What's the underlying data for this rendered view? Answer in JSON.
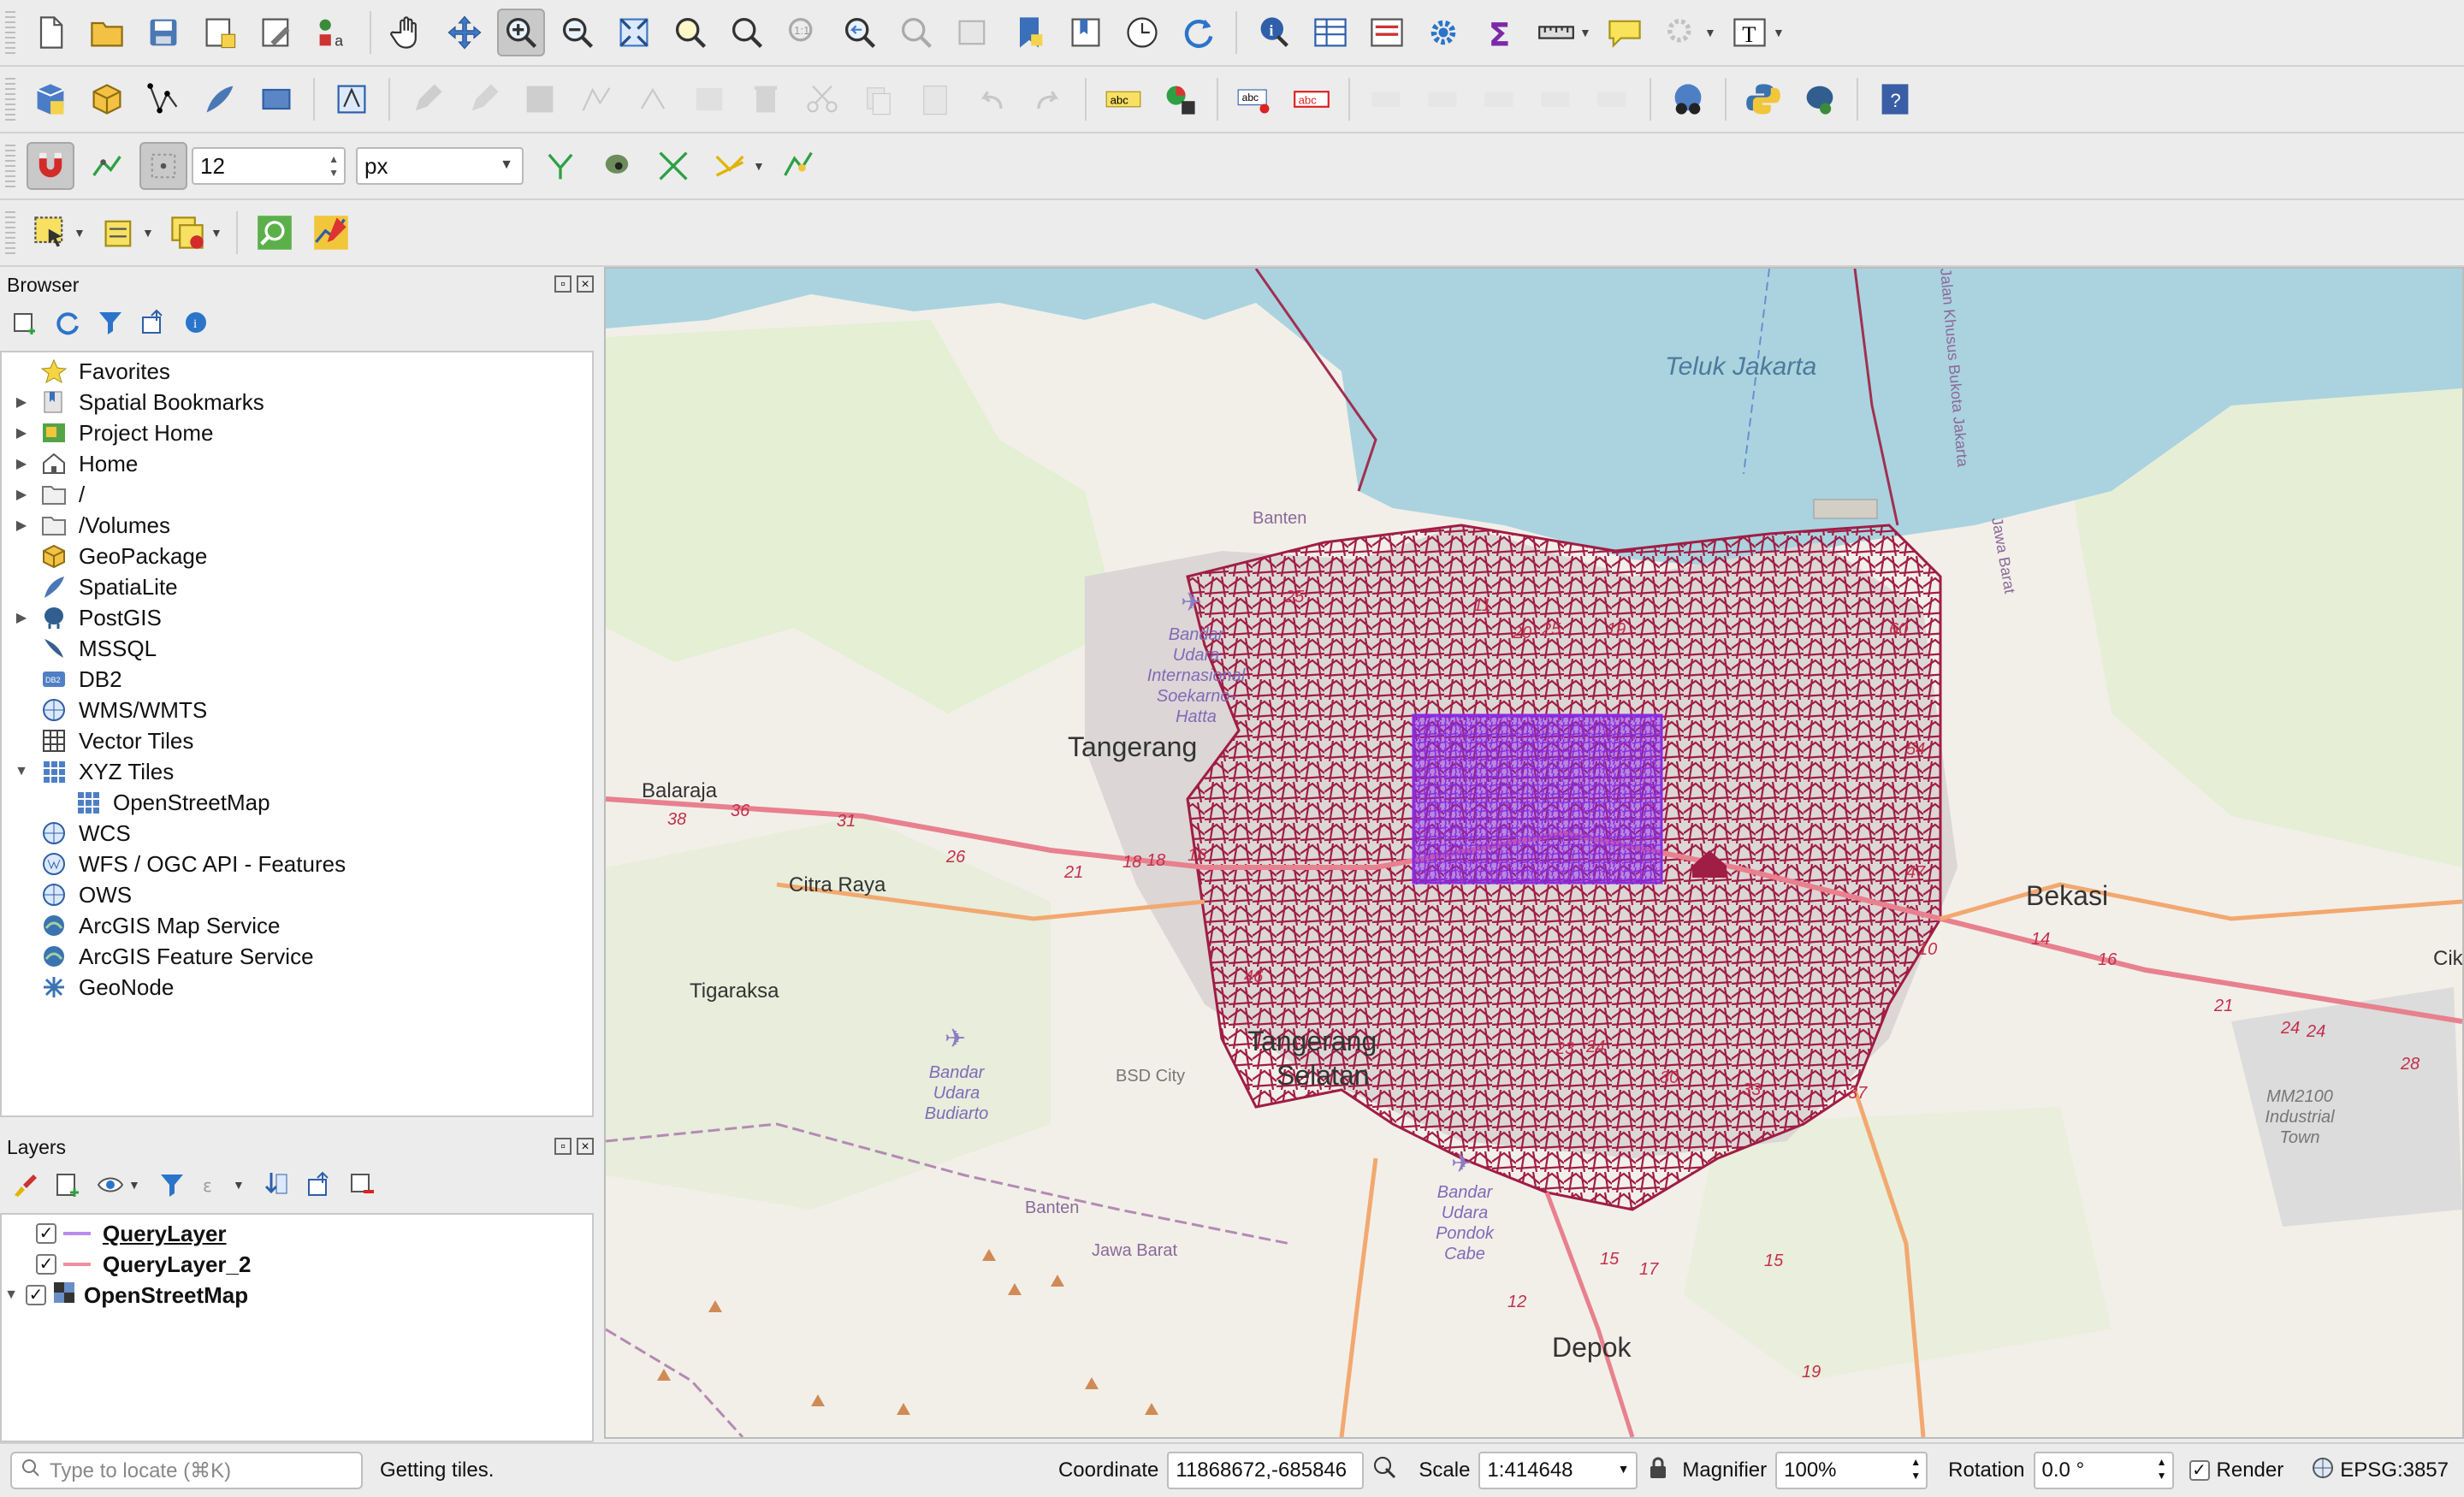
{
  "toolbar": {
    "snapping": {
      "tolerance_value": "12",
      "unit": "px"
    }
  },
  "browser": {
    "title": "Browser",
    "items": [
      {
        "label": "Favorites",
        "icon": "star-icon",
        "expandable": false
      },
      {
        "label": "Spatial Bookmarks",
        "icon": "bookmark-icon",
        "expandable": true
      },
      {
        "label": "Project Home",
        "icon": "project-home-icon",
        "expandable": true
      },
      {
        "label": "Home",
        "icon": "home-icon",
        "expandable": true
      },
      {
        "label": "/",
        "icon": "folder-icon",
        "expandable": true
      },
      {
        "label": "/Volumes",
        "icon": "folder-icon",
        "expandable": true
      },
      {
        "label": "GeoPackage",
        "icon": "geopackage-icon",
        "expandable": false
      },
      {
        "label": "SpatiaLite",
        "icon": "spatialite-icon",
        "expandable": false
      },
      {
        "label": "PostGIS",
        "icon": "postgis-icon",
        "expandable": true
      },
      {
        "label": "MSSQL",
        "icon": "mssql-icon",
        "expandable": false
      },
      {
        "label": "DB2",
        "icon": "db2-icon",
        "expandable": false
      },
      {
        "label": "WMS/WMTS",
        "icon": "globe-icon",
        "expandable": false
      },
      {
        "label": "Vector Tiles",
        "icon": "grid-icon",
        "expandable": false
      },
      {
        "label": "XYZ Tiles",
        "icon": "grid-icon",
        "expandable": true,
        "expanded": true
      },
      {
        "label": "OpenStreetMap",
        "icon": "grid-icon",
        "expandable": false,
        "child": true
      },
      {
        "label": "WCS",
        "icon": "globe-icon",
        "expandable": false
      },
      {
        "label": "WFS / OGC API - Features",
        "icon": "wfs-icon",
        "expandable": false
      },
      {
        "label": "OWS",
        "icon": "globe-icon",
        "expandable": false
      },
      {
        "label": "ArcGIS Map Service",
        "icon": "arcgis-icon",
        "expandable": false
      },
      {
        "label": "ArcGIS Feature Service",
        "icon": "arcgis-icon",
        "expandable": false
      },
      {
        "label": "GeoNode",
        "icon": "geonode-icon",
        "expandable": false
      }
    ]
  },
  "layers": {
    "title": "Layers",
    "items": [
      {
        "label": "QueryLayer",
        "checked": true,
        "color": "#b98cf0",
        "style": "bold-underline"
      },
      {
        "label": "QueryLayer_2",
        "checked": true,
        "color": "#ef8fa1",
        "style": "bold"
      },
      {
        "label": "OpenStreetMap",
        "checked": true,
        "color": "raster",
        "style": "bold",
        "expandable": true
      }
    ]
  },
  "map": {
    "labels": {
      "bay": "Teluk Jakarta",
      "tangerang": "Tangerang",
      "balaraja": "Balaraja",
      "citra_raya": "Citra Raya",
      "tigaraksa": "Tigaraksa",
      "tangerang_selatan_1": "Tangerang",
      "tangerang_selatan_2": "Selatan",
      "bekasi": "Bekasi",
      "depok": "Depok",
      "banten_top": "Banten",
      "banten_bottom": "Banten",
      "jawa_barat": "Jawa Barat",
      "bsd": "BSD City",
      "cikarang": "Cikar",
      "airport1": [
        "Bandar",
        "Udara",
        "Internasional",
        "Soekarno-",
        "Hatta"
      ],
      "airport2": [
        "Bandar",
        "Udara",
        "Budiarto"
      ],
      "airport3": [
        "Bandar",
        "Udara",
        "Pondok",
        "Cabe"
      ],
      "mm2100": [
        "MM2100",
        "Industrial",
        "Town"
      ],
      "toll_road": "Jalan Khusus Bukota Jakarta",
      "jawa_barat_top": "Jawa Barat"
    },
    "route_numbers": [
      "38",
      "36",
      "31",
      "26",
      "21",
      "18",
      "18",
      "16",
      "25",
      "11",
      "20",
      "25",
      "19",
      "60",
      "54",
      "47",
      "14",
      "16",
      "21",
      "24",
      "24",
      "28",
      "15",
      "17",
      "15",
      "12",
      "19",
      "23",
      "24",
      "30",
      "33",
      "37",
      "46",
      "10"
    ],
    "colors": {
      "water": "#aad3df",
      "land": "#f2efe9",
      "road_network": "#a01d45",
      "query_layer": "#8a2be2"
    }
  },
  "status": {
    "locate_placeholder": "Type to locate (⌘K)",
    "message": "Getting tiles.",
    "coordinate_label": "Coordinate",
    "coordinate_value": "11868672,-685846",
    "scale_label": "Scale",
    "scale_value": "1:414648",
    "magnifier_label": "Magnifier",
    "magnifier_value": "100%",
    "rotation_label": "Rotation",
    "rotation_value": "0.0 °",
    "render_label": "Render",
    "render_checked": true,
    "crs": "EPSG:3857"
  }
}
